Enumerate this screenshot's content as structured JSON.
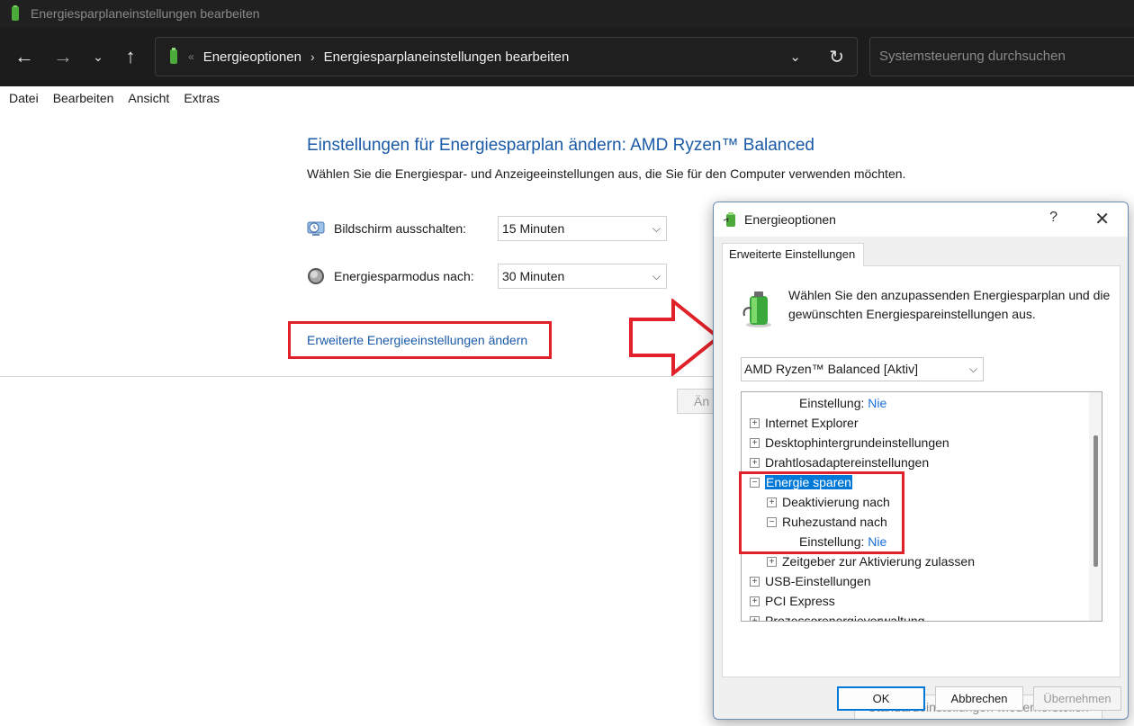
{
  "window": {
    "title": "Energiesparplaneinstellungen bearbeiten",
    "accent_color": "#1a5aa8"
  },
  "address_bar": {
    "breadcrumb_root": "Energieoptionen",
    "breadcrumb_current": "Energiesparplaneinstellungen bearbeiten",
    "search_placeholder": "Systemsteuerung durchsuchen"
  },
  "menu": {
    "items": [
      "Datei",
      "Bearbeiten",
      "Ansicht",
      "Extras"
    ]
  },
  "main": {
    "title": "Einstellungen für Energiesparplan ändern: AMD Ryzen™ Balanced",
    "subtitle": "Wählen Sie die Energiespar- und Anzeigeeinstellungen aus, die Sie für den Computer verwenden möchten.",
    "display_off_label": "Bildschirm ausschalten:",
    "display_off_value": "15 Minuten",
    "sleep_label": "Energiesparmodus nach:",
    "sleep_value": "30 Minuten",
    "advanced_link": "Erweiterte Energieeinstellungen ändern",
    "partial_button": "Än"
  },
  "dialog": {
    "title": "Energieoptionen",
    "help": "?",
    "tab": "Erweiterte Einstellungen",
    "description": "Wählen Sie den anzupassenden Energiesparplan und die gewünschten Energiespareinstellungen aus.",
    "plan_select": "AMD Ryzen™ Balanced [Aktiv]",
    "tree": {
      "top_setting_label": "Einstellung:",
      "top_setting_value": "Nie",
      "internet_explorer": "Internet Explorer",
      "desktop_bg": "Desktophintergrundeinstellungen",
      "wireless": "Drahtlosadaptereinstellungen",
      "sleep": "Energie sparen",
      "deactivation_after": "Deaktivierung nach",
      "hibernate_after": "Ruhezustand nach",
      "setting_label": "Einstellung:",
      "setting_value": "Nie",
      "wake_timers": "Zeitgeber zur Aktivierung zulassen",
      "usb": "USB-Einstellungen",
      "pci": "PCI Express",
      "processor": "Prozessorenergieverwaltung"
    },
    "restore_button": "Standardeinstellungen wiederherstellen",
    "ok_button": "OK",
    "cancel_button": "Abbrechen",
    "apply_button": "Übernehmen"
  }
}
